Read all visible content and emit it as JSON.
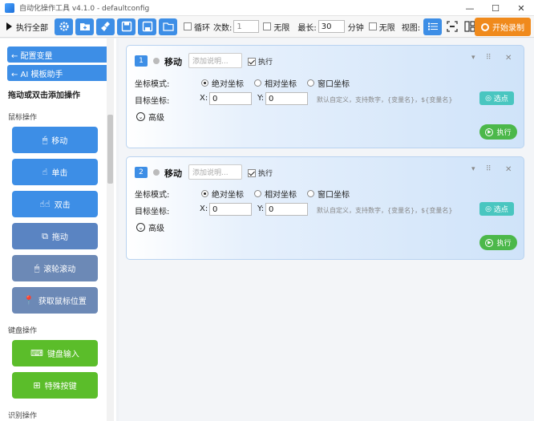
{
  "window": {
    "title": "自动化操作工具 v4.1.0 - defaultconfig",
    "controls": [
      "—",
      "☐",
      "✕"
    ]
  },
  "toolbar": {
    "run_all": "执行全部",
    "buttons": [
      "settings-icon",
      "folder-add-icon",
      "clean-icon",
      "save-icon",
      "save-as-icon",
      "open-folder-icon"
    ],
    "loop_label": "循环",
    "count_label": "次数:",
    "count_value": "1",
    "unlimited_label": "无限",
    "max_label": "最长:",
    "max_value": "30",
    "minutes_label": "分钟",
    "unlimited2_label": "无限",
    "view_label": "视图:",
    "record_label": "开始录制",
    "accent": "#3d8ee6",
    "record_color": "#f08a1c"
  },
  "sidebar": {
    "config_vars": "← 配置变量",
    "ai_helper": "← AI 模板助手",
    "hint": "拖动或双击添加操作",
    "mouse_group": "鼠标操作",
    "mouse_items": [
      "移动",
      "单击",
      "双击",
      "拖动",
      "滚轮滚动",
      "获取鼠标位置"
    ],
    "keyboard_group": "键盘操作",
    "keyboard_items": [
      "键盘输入",
      "特殊按键"
    ],
    "recognize_group": "识别操作"
  },
  "cards": [
    {
      "index": "1",
      "title": "移动",
      "desc_placeholder": "添加说明...",
      "exec_label": "执行",
      "mode_label": "坐标模式:",
      "modes": [
        "绝对坐标",
        "相对坐标",
        "窗口坐标"
      ],
      "selected_mode": "绝对坐标",
      "target_label": "目标坐标:",
      "x_label": "X:",
      "x_value": "0",
      "y_label": "Y:",
      "y_value": "0",
      "hint": "默认自定义，支持数字，{变量名}，${变量名}",
      "pick_label": "选点",
      "advanced_label": "高级",
      "run_label": "执行"
    },
    {
      "index": "2",
      "title": "移动",
      "desc_placeholder": "添加说明...",
      "exec_label": "执行",
      "mode_label": "坐标模式:",
      "modes": [
        "绝对坐标",
        "相对坐标",
        "窗口坐标"
      ],
      "selected_mode": "绝对坐标",
      "target_label": "目标坐标:",
      "x_label": "X:",
      "x_value": "0",
      "y_label": "Y:",
      "y_value": "0",
      "hint": "默认自定义，支持数字，{变量名}，${变量名}",
      "pick_label": "选点",
      "advanced_label": "高级",
      "run_label": "执行"
    }
  ]
}
